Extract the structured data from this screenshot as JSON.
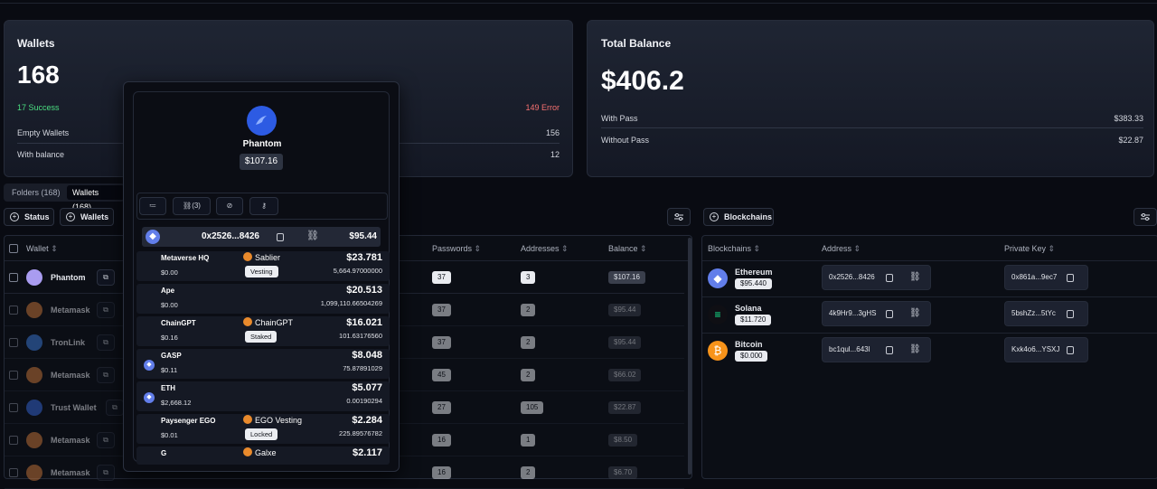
{
  "wallets_card": {
    "title": "Wallets",
    "total": "168",
    "success": "17 Success",
    "error": "149 Error",
    "rows": [
      {
        "label": "Empty Wallets",
        "value": "156"
      },
      {
        "label": "With balance",
        "value": "12"
      }
    ]
  },
  "balance_card": {
    "title": "Total Balance",
    "total": "$406.2",
    "rows": [
      {
        "label": "With Pass",
        "value": "$383.33"
      },
      {
        "label": "Without Pass",
        "value": "$22.87"
      }
    ]
  },
  "tabs": [
    {
      "label": "Folders (168)",
      "active": false
    },
    {
      "label": "Wallets (168)",
      "active": true
    }
  ],
  "filters": {
    "status": "Status",
    "wallets": "Wallets",
    "blockchains": "Blockchains"
  },
  "wallet_table": {
    "headers": {
      "wallet": "Wallet",
      "passwords": "Passwords",
      "addresses": "Addresses",
      "balance": "Balance"
    },
    "rows": [
      {
        "name": "Phantom",
        "icon": "phantom-icon",
        "passwords": "37",
        "addresses": "3",
        "balance": "$107.16",
        "dim": false
      },
      {
        "name": "Metamask",
        "icon": "metamask-icon",
        "passwords": "37",
        "addresses": "2",
        "balance": "$95.44",
        "dim": true
      },
      {
        "name": "TronLink",
        "icon": "tronlink-icon",
        "passwords": "37",
        "addresses": "2",
        "balance": "$95.44",
        "dim": true
      },
      {
        "name": "Metamask",
        "icon": "metamask-icon",
        "passwords": "45",
        "addresses": "2",
        "balance": "$66.02",
        "dim": true
      },
      {
        "name": "Trust Wallet",
        "icon": "trust-wallet-icon",
        "passwords": "27",
        "addresses": "105",
        "balance": "$22.87",
        "dim": true
      },
      {
        "name": "Metamask",
        "icon": "metamask-icon",
        "passwords": "16",
        "addresses": "1",
        "balance": "$8.50",
        "dim": true
      },
      {
        "name": "Metamask",
        "icon": "metamask-icon",
        "passwords": "16",
        "addresses": "2",
        "balance": "$6.70",
        "dim": true
      }
    ]
  },
  "chain_table": {
    "headers": {
      "blockchains": "Blockchains",
      "address": "Address",
      "private_key": "Private Key"
    },
    "rows": [
      {
        "name": "Ethereum",
        "value": "$95.440",
        "address": "0x2526...8426",
        "key": "0x861a...9ec7",
        "icon": "ethereum-icon"
      },
      {
        "name": "Solana",
        "value": "$11.720",
        "address": "4k9Hr9...3gHS",
        "key": "5bshZz...5tYc",
        "icon": "solana-icon"
      },
      {
        "name": "Bitcoin",
        "value": "$0.000",
        "address": "bc1qul...643l",
        "key": "Kxk4o6...YSXJ",
        "icon": "bitcoin-icon"
      }
    ]
  },
  "popup": {
    "wallet_name": "Phantom",
    "wallet_balance": "$107.16",
    "actions": {
      "links_label": "(3)"
    },
    "address_bar": {
      "address": "0x2526...8426",
      "value": "$95.44"
    },
    "tokens": [
      {
        "name": "Metaverse HQ",
        "price": "$0.00",
        "protocol": "Sablier",
        "tag": "Vesting",
        "usd": "$23.781",
        "amount": "5,664.97000000",
        "chain_icon": false
      },
      {
        "name": "Ape",
        "price": "$0.00",
        "protocol": "",
        "tag": "",
        "usd": "$20.513",
        "amount": "1,099,110.66504269",
        "chain_icon": false
      },
      {
        "name": "ChainGPT",
        "price": "$0.16",
        "protocol": "ChainGPT",
        "tag": "Staked",
        "usd": "$16.021",
        "amount": "101.63176560",
        "chain_icon": false
      },
      {
        "name": "GASP",
        "price": "$0.11",
        "protocol": "",
        "tag": "",
        "usd": "$8.048",
        "amount": "75.87891029",
        "chain_icon": true
      },
      {
        "name": "ETH",
        "price": "$2,668.12",
        "protocol": "",
        "tag": "",
        "usd": "$5.077",
        "amount": "0.00190294",
        "chain_icon": true
      },
      {
        "name": "Paysenger EGO",
        "price": "$0.01",
        "protocol": "EGO Vesting",
        "tag": "Locked",
        "usd": "$2.284",
        "amount": "225.89576782",
        "chain_icon": false
      },
      {
        "name": "G",
        "price": "",
        "protocol": "Galxe",
        "tag": "",
        "usd": "$2.117",
        "amount": "",
        "chain_icon": false
      }
    ]
  },
  "colors": {
    "success": "#4ade80",
    "error": "#f87171",
    "accent": "#3b6cf6"
  }
}
